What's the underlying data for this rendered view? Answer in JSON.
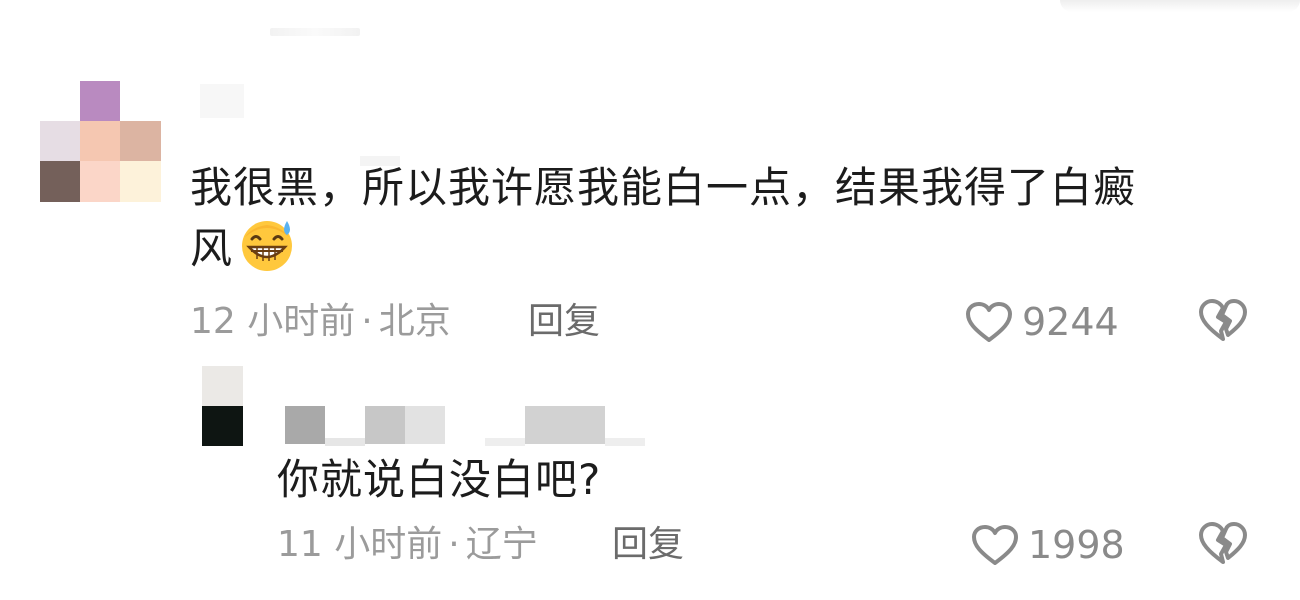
{
  "comments": [
    {
      "text_line1": "我很黑，所以我许愿我能白一点，结果我得了白癜",
      "text_line2": "风",
      "emoji": "sweat-smile-emoji",
      "time": "12 小时前",
      "location": "北京",
      "dot": "·",
      "reply_label": "回复",
      "likes": "9244"
    },
    {
      "text": "你就说白没白吧?",
      "time": "11 小时前",
      "location": "辽宁",
      "dot": "·",
      "reply_label": "回复",
      "likes": "1998"
    }
  ],
  "icons": {
    "like": "heart-outline-icon",
    "dislike": "broken-heart-icon"
  },
  "colors": {
    "text": "#1c1c1c",
    "meta": "#9b9b9b",
    "reply": "#6b6b6b",
    "icon": "#8a8a8a"
  }
}
